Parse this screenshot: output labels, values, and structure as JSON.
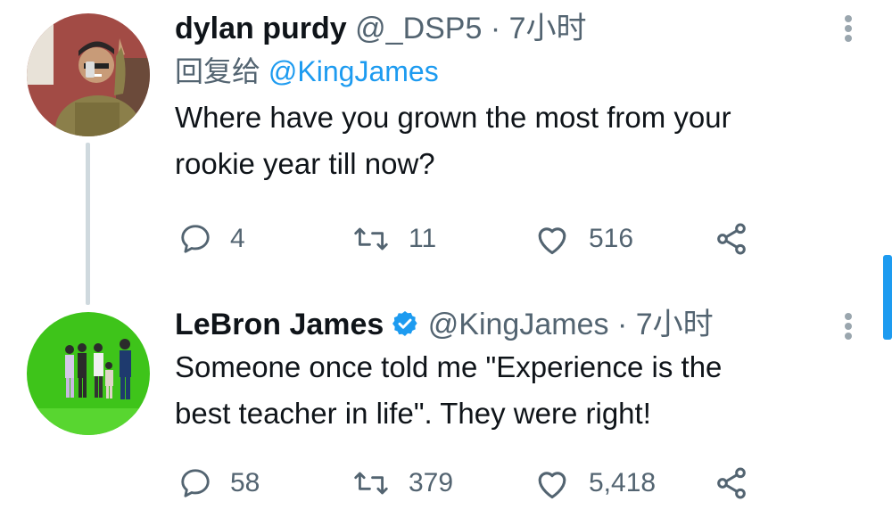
{
  "tweets": [
    {
      "name": "dylan purdy",
      "handle": "@_DSP5",
      "separator": "·",
      "time": "7小时",
      "reply_prefix": "回复给",
      "reply_handle": "@KingJames",
      "text_line1": "Where have you grown the most from your",
      "text_line2": "rookie year till now?",
      "replies": "4",
      "retweets": "11",
      "likes": "516",
      "verified": false
    },
    {
      "name": "LeBron James",
      "handle": "@KingJames",
      "separator": "·",
      "time": "7小时",
      "text_line1": "Someone once told me \"Experience is the",
      "text_line2": "best teacher in life\". They were right!",
      "replies": "58",
      "retweets": "379",
      "likes": "5,418",
      "verified": true
    }
  ],
  "icons": {
    "reply": "reply-icon",
    "retweet": "retweet-icon",
    "like": "heart-icon",
    "share": "share-icon",
    "more": "more-options-icon",
    "verified": "verified-badge-icon"
  },
  "colors": {
    "accent": "#1d9bf0",
    "muted": "#536471",
    "text": "#0f1419",
    "thread_line": "#cfd9de",
    "green_screen": "#3ec41a"
  }
}
